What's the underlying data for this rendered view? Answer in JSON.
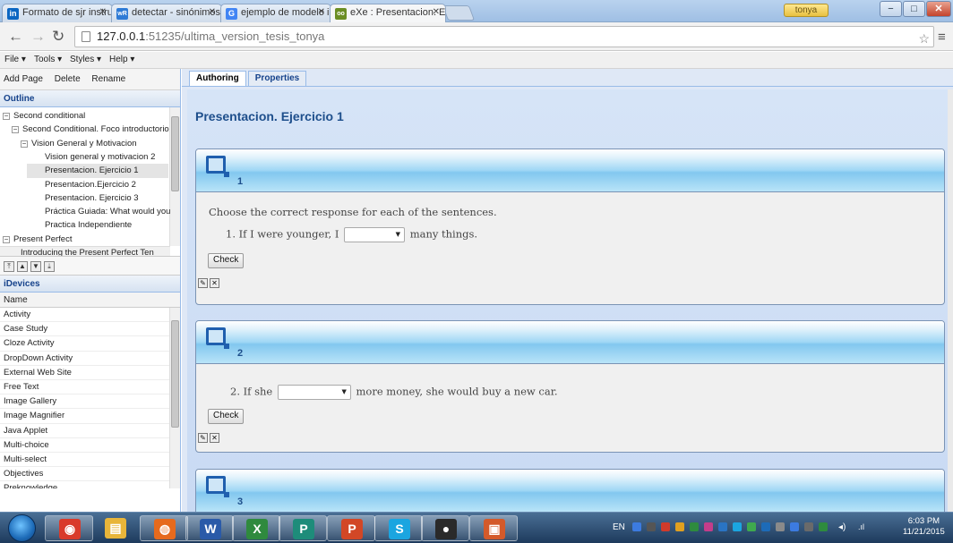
{
  "browser": {
    "tabs": [
      {
        "title": "Formato de sjr instruccion",
        "icon": "linkedin-icon",
        "color": "#0b66c2",
        "glyph": "in"
      },
      {
        "title": "detectar - sinónimos y ant",
        "icon": "wordreference-icon",
        "color": "#2e7bd6",
        "glyph": "wR"
      },
      {
        "title": "ejemplo de modelo instru",
        "icon": "google-icon",
        "color": "#4285f4",
        "glyph": "G"
      },
      {
        "title": "eXe : Presentacion. Ejercic",
        "icon": "exe-icon",
        "color": "#6b8e23",
        "glyph": "oo"
      }
    ],
    "user_badge": "tonya",
    "url_host": "127.0.0.1",
    "url_path": ":51235/ultima_version_tesis_tonya"
  },
  "menubar": {
    "file": "File ▾",
    "tools": "Tools ▾",
    "styles": "Styles ▾",
    "help": "Help ▾"
  },
  "outline": {
    "toolbar": {
      "add": "Add Page",
      "delete": "Delete",
      "rename": "Rename"
    },
    "header": "Outline",
    "items": [
      {
        "label": "Second conditional",
        "level": 0,
        "toggle": "−"
      },
      {
        "label": "Second Conditional. Foco introductorio",
        "level": 1,
        "toggle": "−"
      },
      {
        "label": "Vision General y Motivacion",
        "level": 2,
        "toggle": "−"
      },
      {
        "label": "Vision general y motivacion 2",
        "level": 3,
        "toggle": ""
      },
      {
        "label": "Presentacion. Ejercicio 1",
        "level": 3,
        "toggle": "",
        "selected": true
      },
      {
        "label": "Presentacion.Ejercicio 2",
        "level": 3,
        "toggle": ""
      },
      {
        "label": "Presentacion. Ejercicio 3",
        "level": 3,
        "toggle": ""
      },
      {
        "label": "Práctica Guiada: What would you",
        "level": 3,
        "toggle": ""
      },
      {
        "label": "Practica Independiente",
        "level": 3,
        "toggle": ""
      },
      {
        "label": "Present Perfect",
        "level": 0,
        "toggle": "−"
      },
      {
        "label": "Introducing the Present Perfect Ten",
        "level": 2,
        "toggle": ""
      }
    ]
  },
  "idevices": {
    "header": "iDevices",
    "column": "Name",
    "items": [
      "Activity",
      "Case Study",
      "Cloze Activity",
      "DropDown Activity",
      "External Web Site",
      "Free Text",
      "Image Gallery",
      "Image Magnifier",
      "Java Applet",
      "Multi-choice",
      "Multi-select",
      "Objectives",
      "Preknowledge"
    ]
  },
  "main": {
    "tabs": {
      "authoring": "Authoring",
      "properties": "Properties"
    },
    "page_title": "Presentacion. Ejercicio 1",
    "blocks": [
      {
        "number": "1",
        "instruction": "Choose the correct response for each of the sentences.",
        "q_pre": "1. If I were younger, I",
        "q_post": "many things.",
        "check": "Check"
      },
      {
        "number": "2",
        "q_pre": "2. If she",
        "q_post": "more money, she would buy a new car.",
        "check": "Check"
      },
      {
        "number": "3"
      }
    ]
  },
  "taskbar": {
    "lang": "EN",
    "time": "6:03 PM",
    "date": "11/21/2015",
    "apps": [
      {
        "name": "chrome",
        "color": "#d93a2b",
        "glyph": "◉"
      },
      {
        "name": "explorer",
        "color": "#e8b53a",
        "glyph": "▤"
      },
      {
        "name": "firefox",
        "color": "#e66a1d",
        "glyph": "◍"
      },
      {
        "name": "word",
        "color": "#2a5aa8",
        "glyph": "W"
      },
      {
        "name": "excel",
        "color": "#2f8a3e",
        "glyph": "X"
      },
      {
        "name": "publisher",
        "color": "#1e8c7a",
        "glyph": "P"
      },
      {
        "name": "powerpoint",
        "color": "#d24726",
        "glyph": "P"
      },
      {
        "name": "skype",
        "color": "#1ba5e0",
        "glyph": "S"
      },
      {
        "name": "obs",
        "color": "#2a2a2a",
        "glyph": "●"
      },
      {
        "name": "exe",
        "color": "#d45a2a",
        "glyph": "▣"
      }
    ]
  }
}
